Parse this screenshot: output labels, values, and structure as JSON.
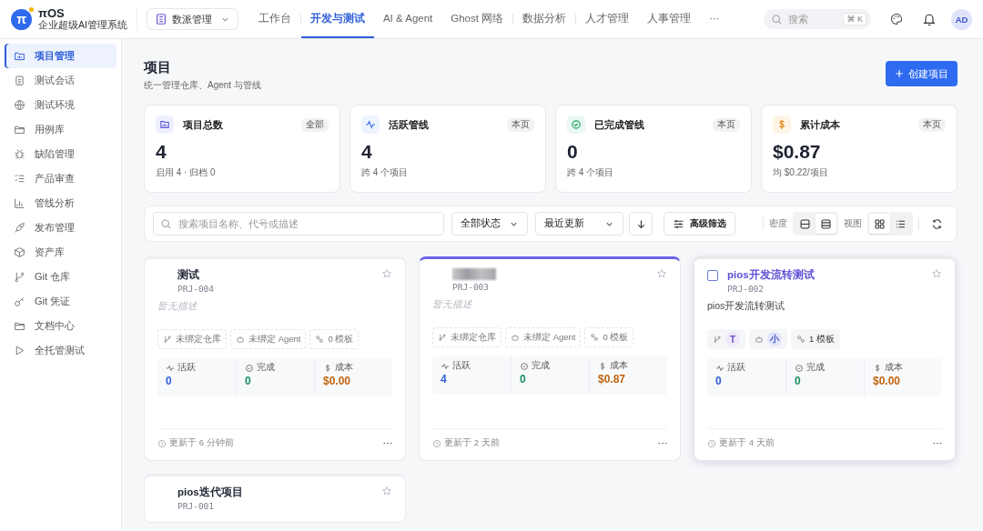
{
  "brand": {
    "logo": "π",
    "name": "πOS",
    "subtitle": "企业超级AI管理系统"
  },
  "workspace": {
    "label": "数派管理"
  },
  "nav": [
    {
      "label": "工作台",
      "selected": false
    },
    {
      "label": "开发与测试",
      "selected": true
    },
    {
      "label": "AI & Agent",
      "selected": false
    },
    {
      "label": "Ghost 网络",
      "selected": false
    },
    {
      "label": "数据分析",
      "selected": false
    },
    {
      "label": "人才管理",
      "selected": false
    },
    {
      "label": "人事管理",
      "selected": false
    },
    {
      "label": "···",
      "selected": false
    }
  ],
  "search": {
    "placeholder": "搜索",
    "shortcut": "⌘ K"
  },
  "avatar": "AD",
  "sidebar": [
    {
      "label": "项目管理",
      "kind": "projects",
      "selected": true
    },
    {
      "label": "测试会话",
      "kind": "sessions",
      "selected": false
    },
    {
      "label": "测试环境",
      "kind": "environments",
      "selected": false
    },
    {
      "label": "用例库",
      "kind": "cases",
      "selected": false
    },
    {
      "label": "缺陷管理",
      "kind": "defects",
      "selected": false
    },
    {
      "label": "产品审查",
      "kind": "review",
      "selected": false
    },
    {
      "label": "管线分析",
      "kind": "analytics",
      "selected": false
    },
    {
      "label": "发布管理",
      "kind": "releases",
      "selected": false
    },
    {
      "label": "资产库",
      "kind": "assets",
      "selected": false
    },
    {
      "label": "Git 仓库",
      "kind": "repos",
      "selected": false
    },
    {
      "label": "Git 凭证",
      "kind": "credentials",
      "selected": false
    },
    {
      "label": "文档中心",
      "kind": "docs",
      "selected": false
    },
    {
      "label": "全托管测试",
      "kind": "autotest",
      "selected": false
    }
  ],
  "page": {
    "title": "项目",
    "subtitle": "统一管理仓库、Agent 与管线",
    "create_button": "创建项目"
  },
  "stats": [
    {
      "kind": "folder",
      "label": "项目总数",
      "badge": "全部",
      "value": "4",
      "note": "启用 4 · 归档 0"
    },
    {
      "kind": "activity",
      "label": "活跃管线",
      "badge": "本页",
      "value": "4",
      "note": "跨 4 个项目"
    },
    {
      "kind": "check",
      "label": "已完成管线",
      "badge": "本页",
      "value": "0",
      "note": "跨 4 个项目"
    },
    {
      "kind": "cost",
      "label": "累计成本",
      "badge": "本页",
      "value": "$0.87",
      "note": "均 $0.22/项目"
    }
  ],
  "toolbar": {
    "search_placeholder": "搜索项目名称、代号或描述",
    "status_filter": "全部状态",
    "sort": "最近更新",
    "advanced": "高级筛选",
    "density_label": "密度",
    "view_label": "视图",
    "density": [
      {
        "kind": "compact",
        "selected": false
      },
      {
        "kind": "comfortable",
        "selected": true
      }
    ],
    "view": [
      {
        "kind": "grid",
        "selected": true
      },
      {
        "kind": "list",
        "selected": false
      }
    ]
  },
  "projects": [
    {
      "name": "测试",
      "redacted": false,
      "code": "PRJ-004",
      "description": "暂无描述",
      "has_description": false,
      "accent": false,
      "hovered": false,
      "bindings": [
        {
          "kind": "repo",
          "label": "未绑定仓库"
        },
        {
          "kind": "agent",
          "label": "未绑定 Agent"
        },
        {
          "kind": "template",
          "label": "0 模板"
        }
      ],
      "metrics": [
        {
          "kind": "active",
          "label": "活跃",
          "value": "0"
        },
        {
          "kind": "done",
          "label": "完成",
          "value": "0"
        },
        {
          "kind": "cost",
          "label": "成本",
          "value": "$0.00"
        }
      ],
      "updated": "更新于 6 分钟前"
    },
    {
      "redacted": true,
      "code": "PRJ-003",
      "description": "暂无描述",
      "has_description": false,
      "accent": true,
      "hovered": false,
      "bindings": [
        {
          "kind": "repo",
          "label": "未绑定仓库"
        },
        {
          "kind": "agent",
          "label": "未绑定 Agent"
        },
        {
          "kind": "template",
          "label": "0 模板"
        }
      ],
      "metrics": [
        {
          "kind": "active",
          "label": "活跃",
          "value": "4"
        },
        {
          "kind": "done",
          "label": "完成",
          "value": "0"
        },
        {
          "kind": "cost",
          "label": "成本",
          "value": "$0.87"
        }
      ],
      "updated": "更新于 2 天前"
    },
    {
      "name": "pios开发流转测试",
      "redacted": false,
      "code": "PRJ-002",
      "description": "pios开发流转测试",
      "has_description": true,
      "accent": false,
      "hovered": true,
      "bindings": [
        {
          "kind": "repo",
          "avatar": "T"
        },
        {
          "kind": "agent",
          "avatar": "小"
        },
        {
          "kind": "template",
          "label": "1 模板"
        }
      ],
      "metrics": [
        {
          "kind": "active",
          "label": "活跃",
          "value": "0"
        },
        {
          "kind": "done",
          "label": "完成",
          "value": "0"
        },
        {
          "kind": "cost",
          "label": "成本",
          "value": "$0.00"
        }
      ],
      "updated": "更新于 4 天前"
    },
    {
      "name": "pios迭代项目",
      "redacted": false,
      "code": "PRJ-001",
      "accent": false,
      "hovered": false,
      "partial": true
    }
  ]
}
